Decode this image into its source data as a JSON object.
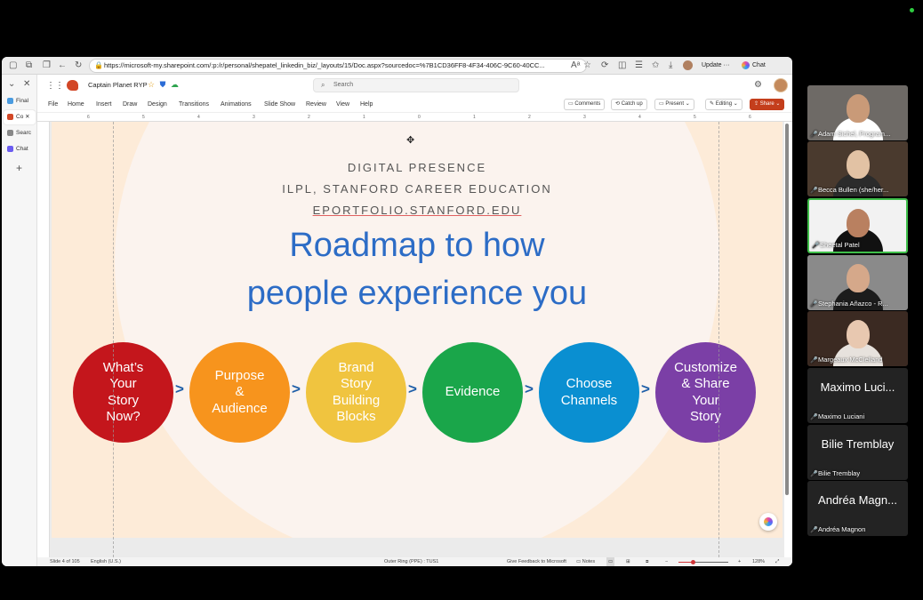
{
  "browser": {
    "url": "https://microsoft-my.sharepoint.com/:p:/r/personal/shepatel_linkedin_biz/_layouts/15/Doc.aspx?sourcedoc=%7B1CD36FF8-4F34-406C-9C60-40CC...",
    "update_label": "Update",
    "chat_label": "Chat",
    "tabs": [
      {
        "label": "Final",
        "color": "#4a9be0"
      },
      {
        "label": "Co",
        "color": "#d24726"
      },
      {
        "label": "Searc",
        "color": "#888888"
      },
      {
        "label": "Chat",
        "color": "#6b5cf0"
      }
    ]
  },
  "app": {
    "doc_title": "Captain Planet RYP",
    "search_placeholder": "Search",
    "menu": [
      "File",
      "Home",
      "Insert",
      "Draw",
      "Design",
      "Transitions",
      "Animations",
      "Slide Show",
      "Review",
      "View",
      "Help"
    ],
    "buttons": {
      "comments": "Comments",
      "catch_up": "Catch up",
      "present": "Present",
      "editing": "Editing",
      "share": "Share"
    },
    "ruler_numbers": [
      "6",
      "5",
      "4",
      "3",
      "2",
      "1",
      "0",
      "1",
      "2",
      "3",
      "4",
      "5",
      "6"
    ]
  },
  "slide": {
    "kicker1": "DIGITAL PRESENCE",
    "kicker2": "ILPL, STANFORD CAREER EDUCATION",
    "link": "EPORTFOLIO.STANFORD.EDU",
    "title_line1": "Roadmap to how",
    "title_line2": "people experience you",
    "steps": [
      {
        "label": "What’s\nYour\nStory\nNow?",
        "color": "#c4161c"
      },
      {
        "label": "Purpose\n&\nAudience",
        "color": "#f7941d"
      },
      {
        "label": "Brand\nStory\nBuilding\nBlocks",
        "color": "#f0c43f"
      },
      {
        "label": "Evidence",
        "color": "#1aa64a"
      },
      {
        "label": "Choose\nChannels",
        "color": "#0a8fd1"
      },
      {
        "label": "Customize\n& Share\nYour\nStory",
        "color": "#7b3fa6"
      }
    ],
    "arrow": ">"
  },
  "status": {
    "slide": "Slide 4 of 105",
    "language": "English (U.S.)",
    "theme": "Outer Ring (PPE) : TUS1",
    "feedback": "Give Feedback to Microsoft",
    "notes": "Notes",
    "zoom": "128%",
    "zoom_fraction": 0.3
  },
  "participants": [
    {
      "name": "Adam Sichel, Program...",
      "video": true,
      "bg": "#6e6a66",
      "skin": "#c99a78",
      "shirt": "#ffffff"
    },
    {
      "name": "Becca Bullen (she/her...",
      "video": true,
      "bg": "#4a3a2e",
      "skin": "#e2c2a4",
      "shirt": "#2b2b2b"
    },
    {
      "name": "Sheetal Patel",
      "video": true,
      "active": true,
      "bg": "#f2f2f2",
      "skin": "#b98060",
      "shirt": "#111111"
    },
    {
      "name": "Stephania Añazco - R...",
      "video": true,
      "bg": "#8a8a8a",
      "skin": "#d5a88a",
      "shirt": "#1c1c1c"
    },
    {
      "name": "Margeaux McClelland",
      "video": true,
      "bg": "#3b2a22",
      "skin": "#e8c8b0",
      "shirt": "#e7e2dd"
    },
    {
      "name": "Maximo Luciani",
      "bigname": "Maximo Luci...",
      "video": false
    },
    {
      "name": "Bilie Tremblay",
      "bigname": "Bilie Tremblay",
      "video": false
    },
    {
      "name": "Andréa Magnon",
      "bigname": "Andréa Magn...",
      "video": false
    }
  ]
}
